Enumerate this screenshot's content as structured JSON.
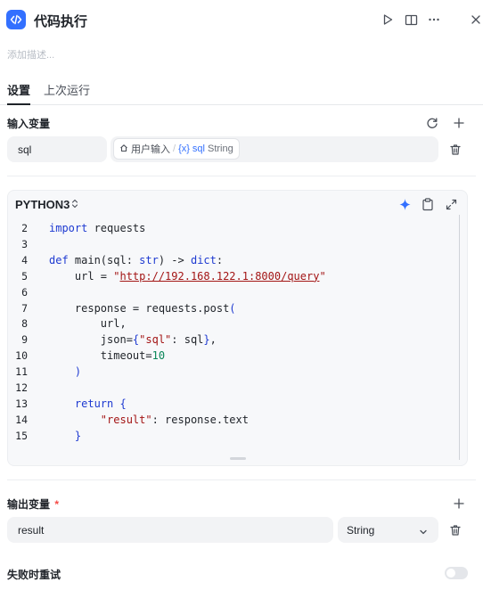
{
  "header": {
    "title": "代码执行"
  },
  "description_placeholder": "添加描述...",
  "tabs": [
    {
      "label": "设置"
    },
    {
      "label": "上次运行"
    }
  ],
  "inputs": {
    "label": "输入变量",
    "var_name": "sql",
    "ref_source": "用户输入",
    "ref_separator": "/",
    "ref_var_icon": "{x}",
    "ref_var": "sql",
    "ref_type": "String"
  },
  "code": {
    "language": "PYTHON3",
    "lines": [
      {
        "n": "2",
        "tokens": [
          {
            "t": "import",
            "c": "kw"
          },
          {
            "t": " requests",
            "c": ""
          }
        ]
      },
      {
        "n": "3",
        "tokens": []
      },
      {
        "n": "4",
        "tokens": [
          {
            "t": "def",
            "c": "kw"
          },
          {
            "t": " main(sql: ",
            "c": ""
          },
          {
            "t": "str",
            "c": "kw"
          },
          {
            "t": ") -> ",
            "c": ""
          },
          {
            "t": "dict",
            "c": "kw"
          },
          {
            "t": ":",
            "c": ""
          }
        ]
      },
      {
        "n": "5",
        "tokens": [
          {
            "t": "    url = ",
            "c": ""
          },
          {
            "t": "\"",
            "c": "str"
          },
          {
            "t": "http://192.168.122.1:8000/query",
            "c": "url"
          },
          {
            "t": "\"",
            "c": "str"
          }
        ]
      },
      {
        "n": "6",
        "tokens": []
      },
      {
        "n": "7",
        "tokens": [
          {
            "t": "    response = requests.post",
            "c": ""
          },
          {
            "t": "(",
            "c": "br"
          }
        ]
      },
      {
        "n": "8",
        "tokens": [
          {
            "t": "        url,",
            "c": ""
          }
        ]
      },
      {
        "n": "9",
        "tokens": [
          {
            "t": "        json=",
            "c": ""
          },
          {
            "t": "{",
            "c": "br"
          },
          {
            "t": "\"sql\"",
            "c": "str"
          },
          {
            "t": ": sql",
            "c": ""
          },
          {
            "t": "}",
            "c": "br"
          },
          {
            "t": ",",
            "c": ""
          }
        ]
      },
      {
        "n": "10",
        "tokens": [
          {
            "t": "        timeout=",
            "c": ""
          },
          {
            "t": "10",
            "c": "num"
          }
        ]
      },
      {
        "n": "11",
        "tokens": [
          {
            "t": "    ",
            "c": ""
          },
          {
            "t": ")",
            "c": "br"
          }
        ]
      },
      {
        "n": "12",
        "tokens": []
      },
      {
        "n": "13",
        "tokens": [
          {
            "t": "    ",
            "c": ""
          },
          {
            "t": "return",
            "c": "kw"
          },
          {
            "t": " ",
            "c": ""
          },
          {
            "t": "{",
            "c": "br"
          }
        ]
      },
      {
        "n": "14",
        "tokens": [
          {
            "t": "        ",
            "c": ""
          },
          {
            "t": "\"result\"",
            "c": "str"
          },
          {
            "t": ": response.text",
            "c": ""
          }
        ]
      },
      {
        "n": "15",
        "tokens": [
          {
            "t": "    ",
            "c": ""
          },
          {
            "t": "}",
            "c": "br"
          }
        ]
      }
    ]
  },
  "outputs": {
    "label": "输出变量",
    "required_mark": "*",
    "var_name": "result",
    "type": "String"
  },
  "retry": {
    "label": "失败时重试"
  },
  "colors": {
    "accent": "#3370ff",
    "keyword": "#1e3ad1",
    "string": "#a31515",
    "number": "#098658",
    "required": "#f54a45"
  },
  "icons": [
    "code-icon",
    "play-icon",
    "book-icon",
    "more-icon",
    "close-icon",
    "refresh-icon",
    "plus-icon",
    "trash-icon",
    "home-icon",
    "sparkle-icon",
    "clipboard-icon",
    "expand-icon",
    "chevron-down-icon",
    "updown-icon"
  ]
}
